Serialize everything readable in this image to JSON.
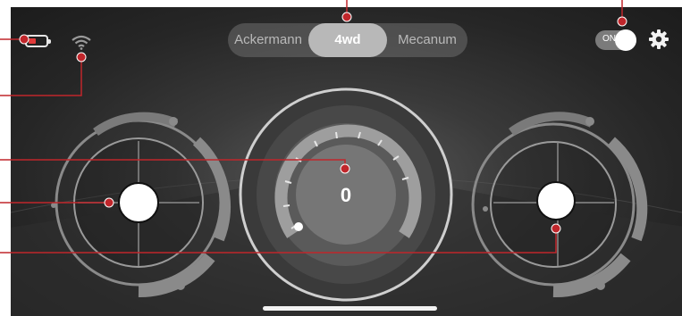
{
  "drive_modes": [
    {
      "label": "Ackermann",
      "active": false
    },
    {
      "label": "4wd",
      "active": true
    },
    {
      "label": "Mecanum",
      "active": false
    }
  ],
  "power_toggle": {
    "label": "ON",
    "state": "on"
  },
  "speedometer": {
    "value": "0"
  },
  "battery": {
    "level": 0.3,
    "color": "#e23a3a"
  },
  "icons": {
    "battery": "battery-icon",
    "wifi": "wifi-icon",
    "settings": "gear-icon"
  },
  "colors": {
    "annotation": "#c0262b",
    "accent": "#ffffff"
  }
}
